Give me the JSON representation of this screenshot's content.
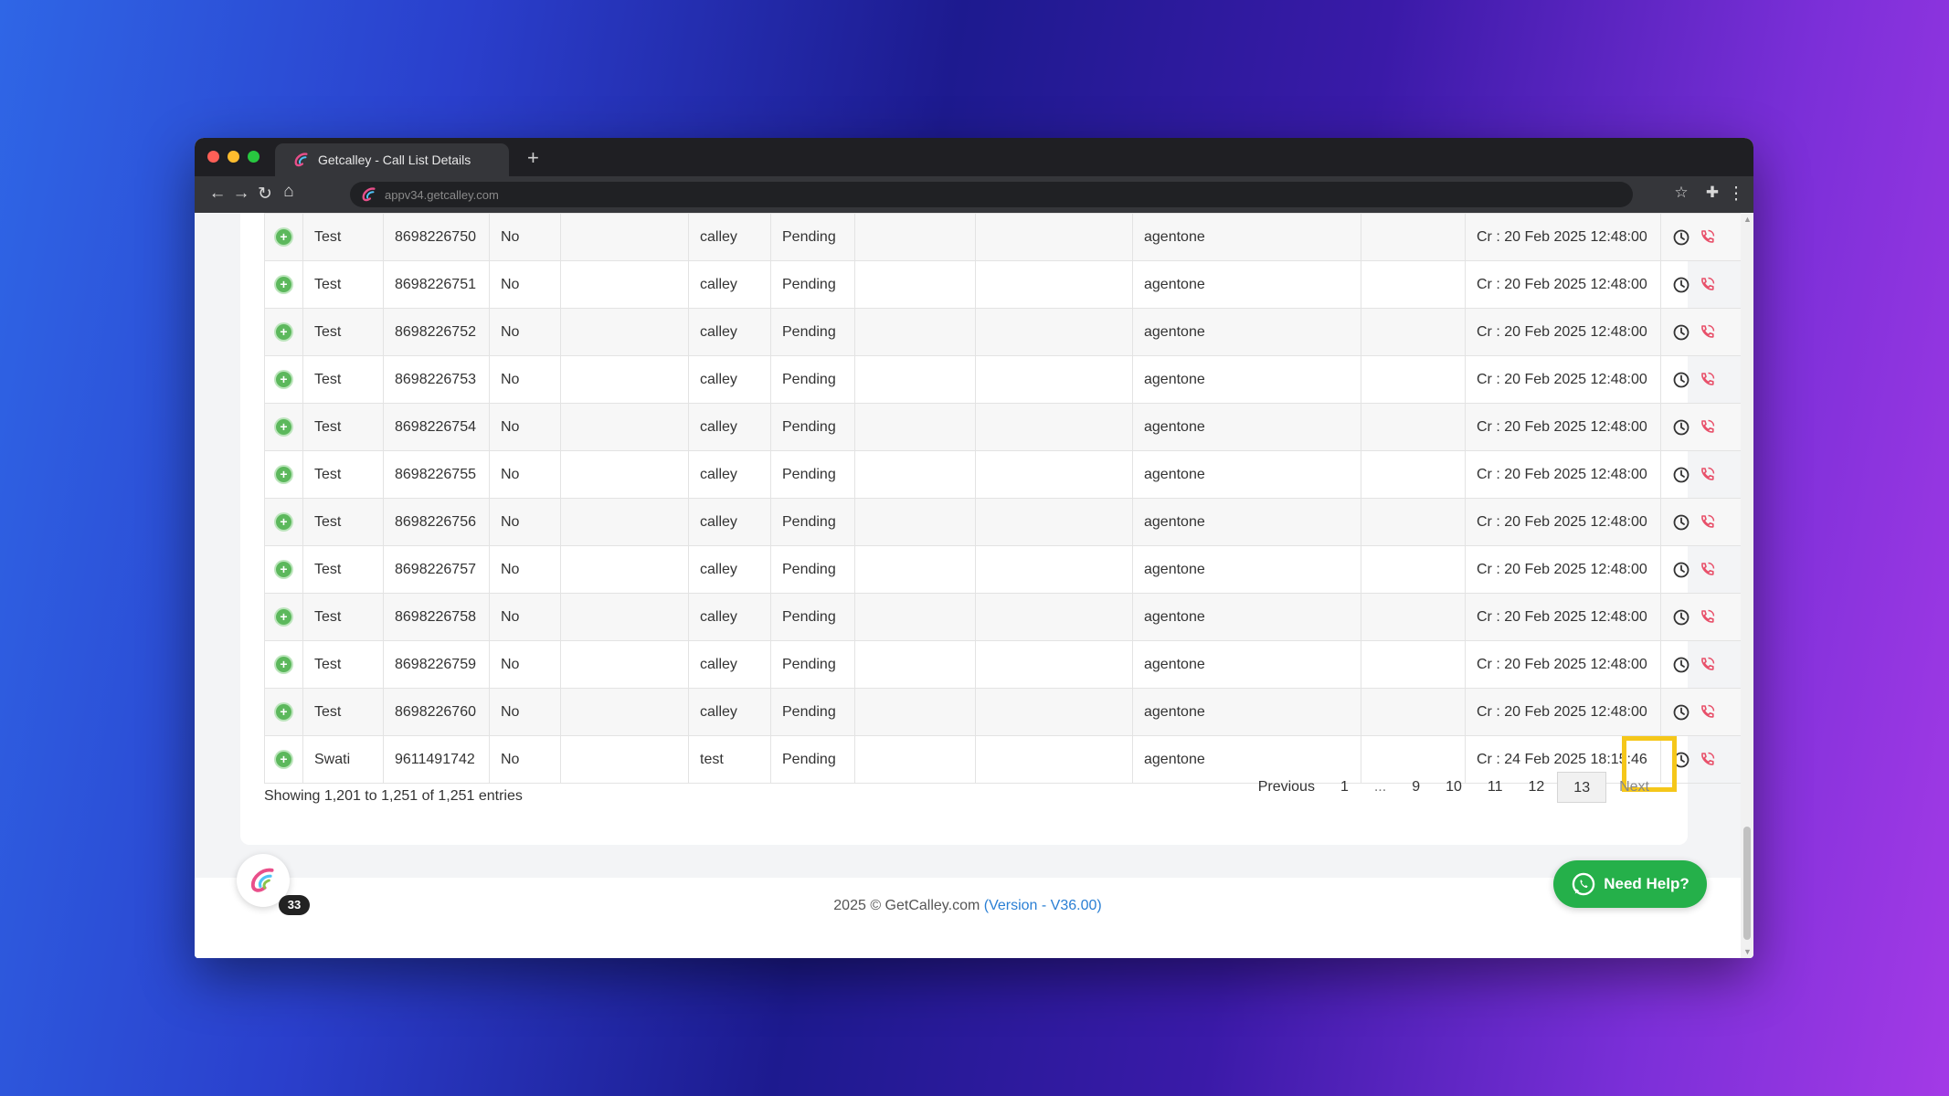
{
  "browser": {
    "tab_title": "Getcalley - Call List Details",
    "new_tab_label": "+",
    "url": "appv34.getcalley.com"
  },
  "table": {
    "rows": [
      {
        "name": "Test",
        "phone": "8698226750",
        "flag": "No",
        "col4": "",
        "list": "calley",
        "status": "Pending",
        "col7": "",
        "col8": "",
        "agent": "agentone",
        "col10": "",
        "created": "Cr : 20 Feb 2025 12:48:00"
      },
      {
        "name": "Test",
        "phone": "8698226751",
        "flag": "No",
        "col4": "",
        "list": "calley",
        "status": "Pending",
        "col7": "",
        "col8": "",
        "agent": "agentone",
        "col10": "",
        "created": "Cr : 20 Feb 2025 12:48:00"
      },
      {
        "name": "Test",
        "phone": "8698226752",
        "flag": "No",
        "col4": "",
        "list": "calley",
        "status": "Pending",
        "col7": "",
        "col8": "",
        "agent": "agentone",
        "col10": "",
        "created": "Cr : 20 Feb 2025 12:48:00"
      },
      {
        "name": "Test",
        "phone": "8698226753",
        "flag": "No",
        "col4": "",
        "list": "calley",
        "status": "Pending",
        "col7": "",
        "col8": "",
        "agent": "agentone",
        "col10": "",
        "created": "Cr : 20 Feb 2025 12:48:00"
      },
      {
        "name": "Test",
        "phone": "8698226754",
        "flag": "No",
        "col4": "",
        "list": "calley",
        "status": "Pending",
        "col7": "",
        "col8": "",
        "agent": "agentone",
        "col10": "",
        "created": "Cr : 20 Feb 2025 12:48:00"
      },
      {
        "name": "Test",
        "phone": "8698226755",
        "flag": "No",
        "col4": "",
        "list": "calley",
        "status": "Pending",
        "col7": "",
        "col8": "",
        "agent": "agentone",
        "col10": "",
        "created": "Cr : 20 Feb 2025 12:48:00"
      },
      {
        "name": "Test",
        "phone": "8698226756",
        "flag": "No",
        "col4": "",
        "list": "calley",
        "status": "Pending",
        "col7": "",
        "col8": "",
        "agent": "agentone",
        "col10": "",
        "created": "Cr : 20 Feb 2025 12:48:00"
      },
      {
        "name": "Test",
        "phone": "8698226757",
        "flag": "No",
        "col4": "",
        "list": "calley",
        "status": "Pending",
        "col7": "",
        "col8": "",
        "agent": "agentone",
        "col10": "",
        "created": "Cr : 20 Feb 2025 12:48:00"
      },
      {
        "name": "Test",
        "phone": "8698226758",
        "flag": "No",
        "col4": "",
        "list": "calley",
        "status": "Pending",
        "col7": "",
        "col8": "",
        "agent": "agentone",
        "col10": "",
        "created": "Cr : 20 Feb 2025 12:48:00"
      },
      {
        "name": "Test",
        "phone": "8698226759",
        "flag": "No",
        "col4": "",
        "list": "calley",
        "status": "Pending",
        "col7": "",
        "col8": "",
        "agent": "agentone",
        "col10": "",
        "created": "Cr : 20 Feb 2025 12:48:00"
      },
      {
        "name": "Test",
        "phone": "8698226760",
        "flag": "No",
        "col4": "",
        "list": "calley",
        "status": "Pending",
        "col7": "",
        "col8": "",
        "agent": "agentone",
        "col10": "",
        "created": "Cr : 20 Feb 2025 12:48:00"
      },
      {
        "name": "Swati",
        "phone": "9611491742",
        "flag": "No",
        "col4": "",
        "list": "test",
        "status": "Pending",
        "col7": "",
        "col8": "",
        "agent": "agentone",
        "col10": "",
        "created": "Cr : 24 Feb 2025 18:15:46"
      }
    ]
  },
  "table_info": "Showing 1,201 to 1,251 of 1,251 entries",
  "pagination": {
    "previous": "Previous",
    "pages": [
      "1",
      "...",
      "9",
      "10",
      "11",
      "12",
      "13"
    ],
    "active": "13",
    "next": "Next"
  },
  "fab": {
    "badge": "33"
  },
  "help_button": "Need Help?",
  "footer": {
    "copyright": "2025 © GetCalley.com",
    "version": "(Version - V36.00)"
  },
  "icons": {
    "expand": "plus-circle-icon",
    "history": "clock-icon",
    "call": "phone-icon"
  },
  "colors": {
    "accent_green": "#5cb85c",
    "call_icon_red": "#e8506a",
    "help_green": "#25b04a",
    "version_link": "#2a7fd4",
    "highlight_box": "#f5c71a"
  }
}
